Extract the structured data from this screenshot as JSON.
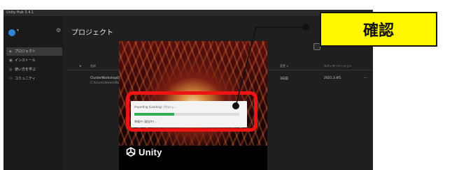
{
  "window": {
    "title": "Unity Hub 3.4.1"
  },
  "sidebar": {
    "items": [
      {
        "icon": "cube-icon",
        "label": "プロジェクト",
        "active": true
      },
      {
        "icon": "lock-icon",
        "label": "インストール",
        "active": false
      },
      {
        "icon": "graduation-icon",
        "label": "使い方を学ぶ",
        "active": false
      },
      {
        "icon": "people-icon",
        "label": "コミュニティ",
        "active": false
      }
    ]
  },
  "main": {
    "title": "プロジェクト",
    "columns": {
      "star": "★",
      "name": "名前",
      "modified": "変更 ↓",
      "editor": "エディターバージョン"
    },
    "rows": [
      {
        "name": "ClusterWorkshop0",
        "path": "C:\\Users\\demo\\WorkshopA",
        "modified": "3日前",
        "editor": "2021.3.4f1",
        "more": "⋯"
      }
    ]
  },
  "splash": {
    "dialog_message": "Importing (Loading) プロジェ...",
    "progress": 0.38,
    "dialog_status": "準備中 (確認中) ...",
    "logo_text": "Unity"
  },
  "annotation": {
    "callout_text": "確認",
    "highlight_color": "#ee1414",
    "callout_color": "#fff700"
  },
  "colors": {
    "accent": "#2f86d4",
    "progress": "#2fae52"
  }
}
